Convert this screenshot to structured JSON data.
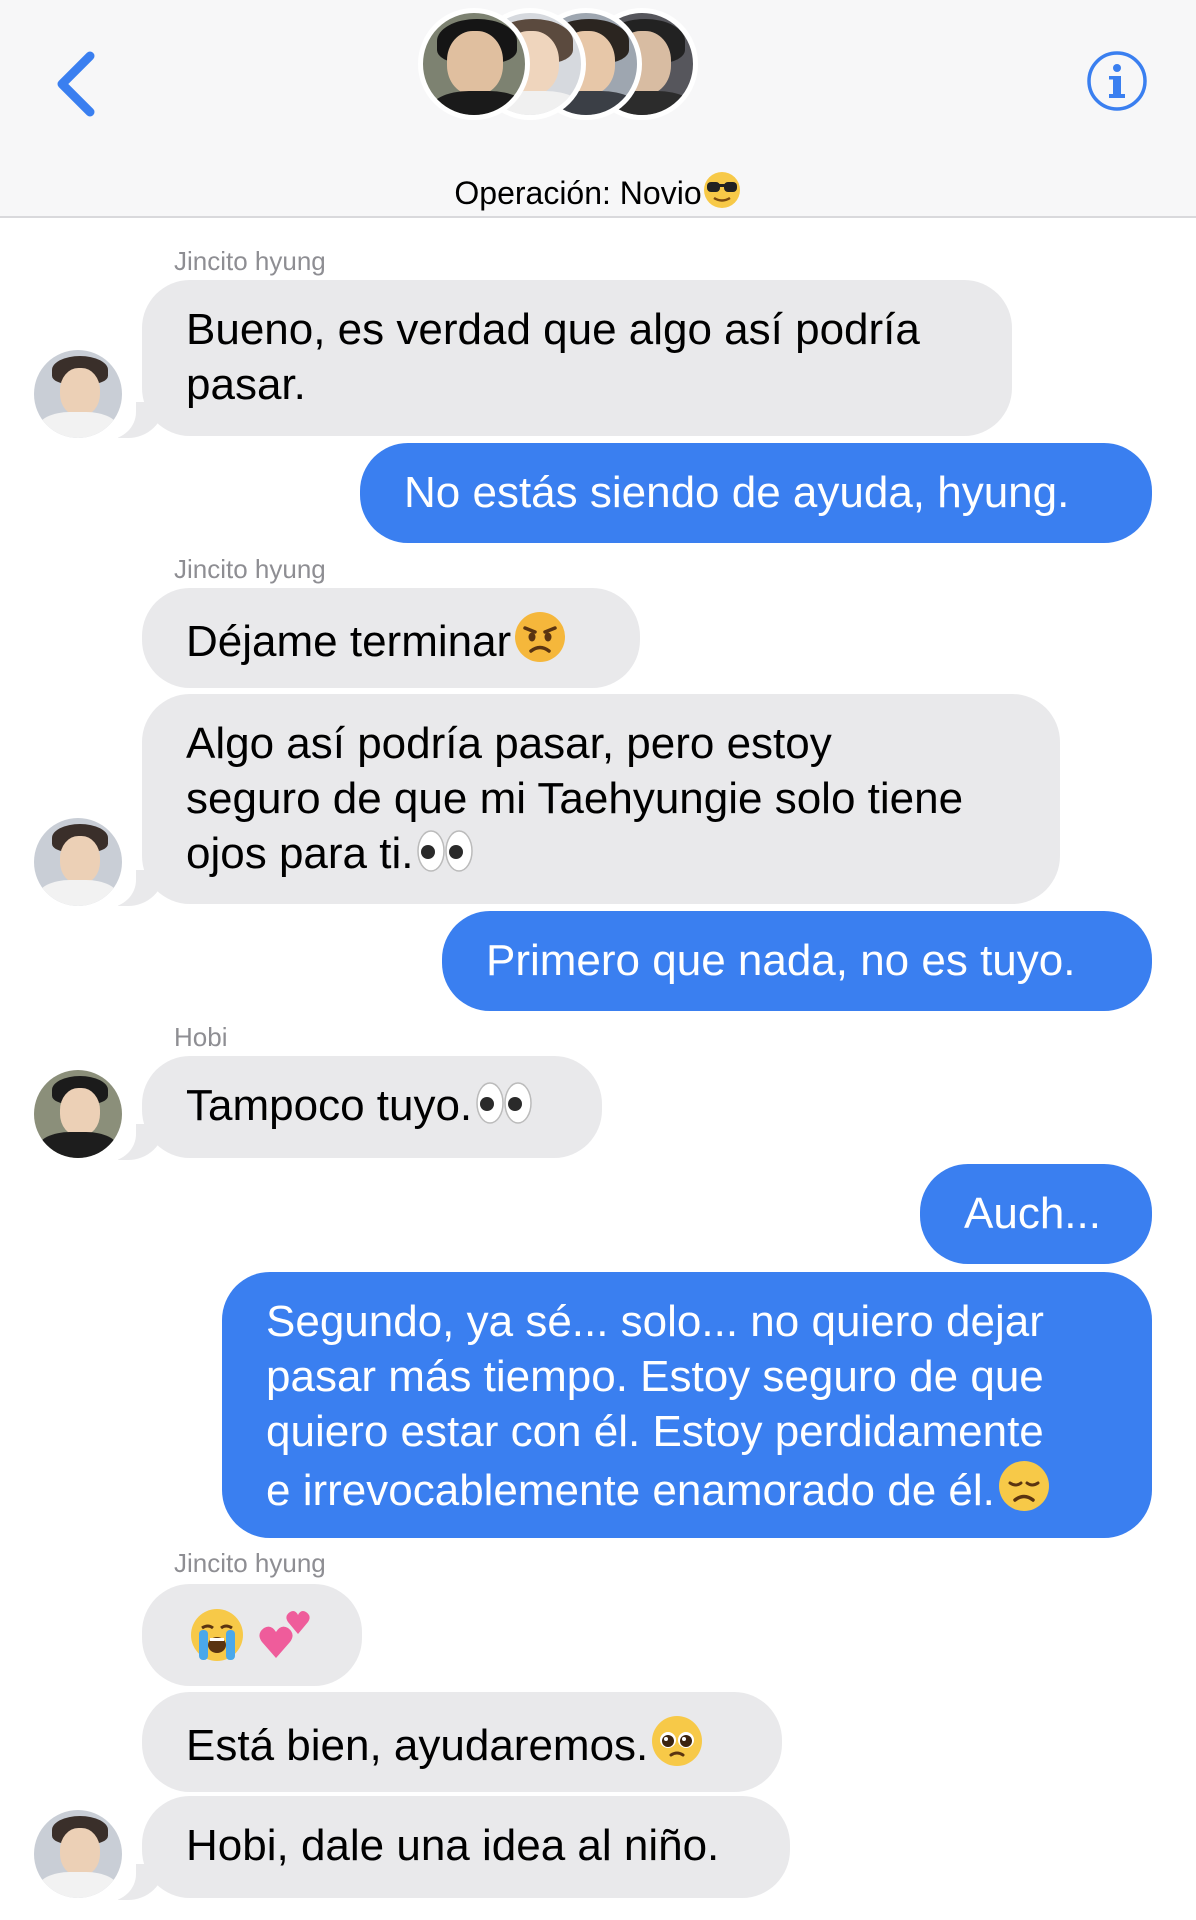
{
  "header": {
    "title": "Operación: Novio",
    "title_emoji": "smiling-face-with-sunglasses",
    "accent": "#3a7ff0",
    "back_icon": "chevron-left-icon",
    "info_icon": "info-circle-icon"
  },
  "colors": {
    "outgoing_bubble": "#3a7ff0",
    "incoming_bubble": "#e9e9eb",
    "sender_label": "#8e8e93"
  },
  "messages": [
    {
      "sender": "Jincito hyung",
      "text": "Bueno, es verdad que algo así podría pasar.",
      "lines": [
        "Bueno, es verdad que algo así podría",
        "pasar."
      ]
    },
    {
      "text": "No estás siendo de ayuda, hyung."
    },
    {
      "sender": "Jincito hyung",
      "text": "Déjame terminar",
      "emoji": "angry-face"
    },
    {
      "text": "Algo así podría pasar, pero estoy seguro de que mi Taehyungie solo tiene ojos para ti.",
      "lines": [
        "Algo así podría pasar, pero estoy",
        "seguro de que mi Taehyungie solo tiene",
        "ojos para ti."
      ],
      "emoji": "eyes"
    },
    {
      "text": "Primero que nada, no es tuyo."
    },
    {
      "sender": "Hobi",
      "text": "Tampoco tuyo.",
      "emoji": "eyes"
    },
    {
      "text": "Auch..."
    },
    {
      "text": "Segundo, ya sé... solo... no quiero dejar pasar más tiempo. Estoy seguro de que quiero estar con él. Estoy perdidamente e irrevocablemente enamorado de él.",
      "lines": [
        "Segundo, ya sé... solo... no quiero dejar",
        "pasar más tiempo. Estoy seguro de que",
        "quiero estar con él. Estoy perdidamente",
        "e irrevocablemente enamorado de él."
      ],
      "emoji": "disappointed-face"
    },
    {
      "sender": "Jincito hyung",
      "emoji": "loudly-crying-face two-hearts"
    },
    {
      "text": "Está bien, ayudaremos.",
      "emoji": "pleading-face"
    },
    {
      "text": "Hobi, dale una idea al niño."
    }
  ]
}
